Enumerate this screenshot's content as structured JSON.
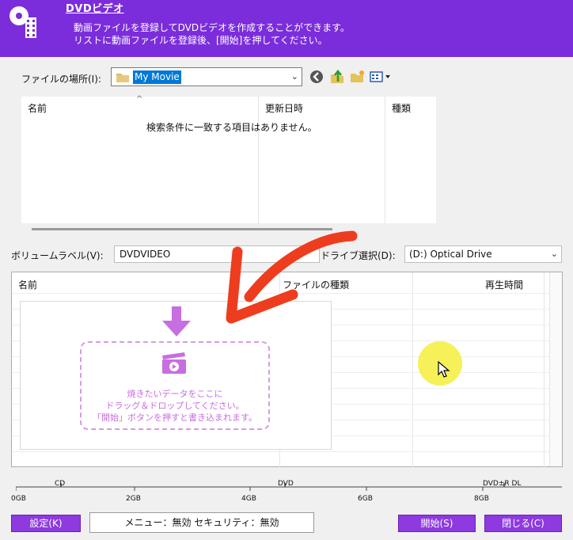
{
  "header": {
    "title": "DVDビデオ",
    "desc_line1": "動画ファイルを登録してDVDビデオを作成することができます。",
    "desc_line2": "リストに動画ファイルを登録後、[開始]を押してください。"
  },
  "colors": {
    "header_bg": "#7b2ddb",
    "button_bg": "#8e3ae0",
    "drop_accent": "#c76ee0",
    "selection": "#0078d7"
  },
  "location": {
    "label": "ファイルの場所(I):",
    "value": "My Movie"
  },
  "toolbar_icons": [
    "back-icon",
    "up-folder-icon",
    "new-folder-icon",
    "view-menu-icon"
  ],
  "file_list": {
    "columns": [
      "名前",
      "更新日時",
      "種類"
    ],
    "empty_message": "検索条件に一致する項目はありません。"
  },
  "volume": {
    "label": "ボリュームラベル(V):",
    "value": "DVDVIDEO"
  },
  "drive": {
    "label": "ドライブ選択(D):",
    "value": "(D:)  Optical Drive"
  },
  "track_list": {
    "columns": [
      "名前",
      "ファイルの種類",
      "再生時間"
    ]
  },
  "drop_zone": {
    "line1": "焼きたいデータをここに",
    "line2": "ドラッグ＆ドロップしてください。",
    "line3": "「開始」ボタンを押すと書き込まれます。"
  },
  "capacity": {
    "markers": [
      "CD",
      "DVD",
      "DVD±R DL"
    ],
    "scale": [
      "0GB",
      "2GB",
      "4GB",
      "6GB",
      "8GB"
    ]
  },
  "buttons": {
    "settings": "設定(K)",
    "start": "開始(S)",
    "close": "閉じる(C)"
  },
  "status": "メニュー：無効 セキュリティ：無効"
}
